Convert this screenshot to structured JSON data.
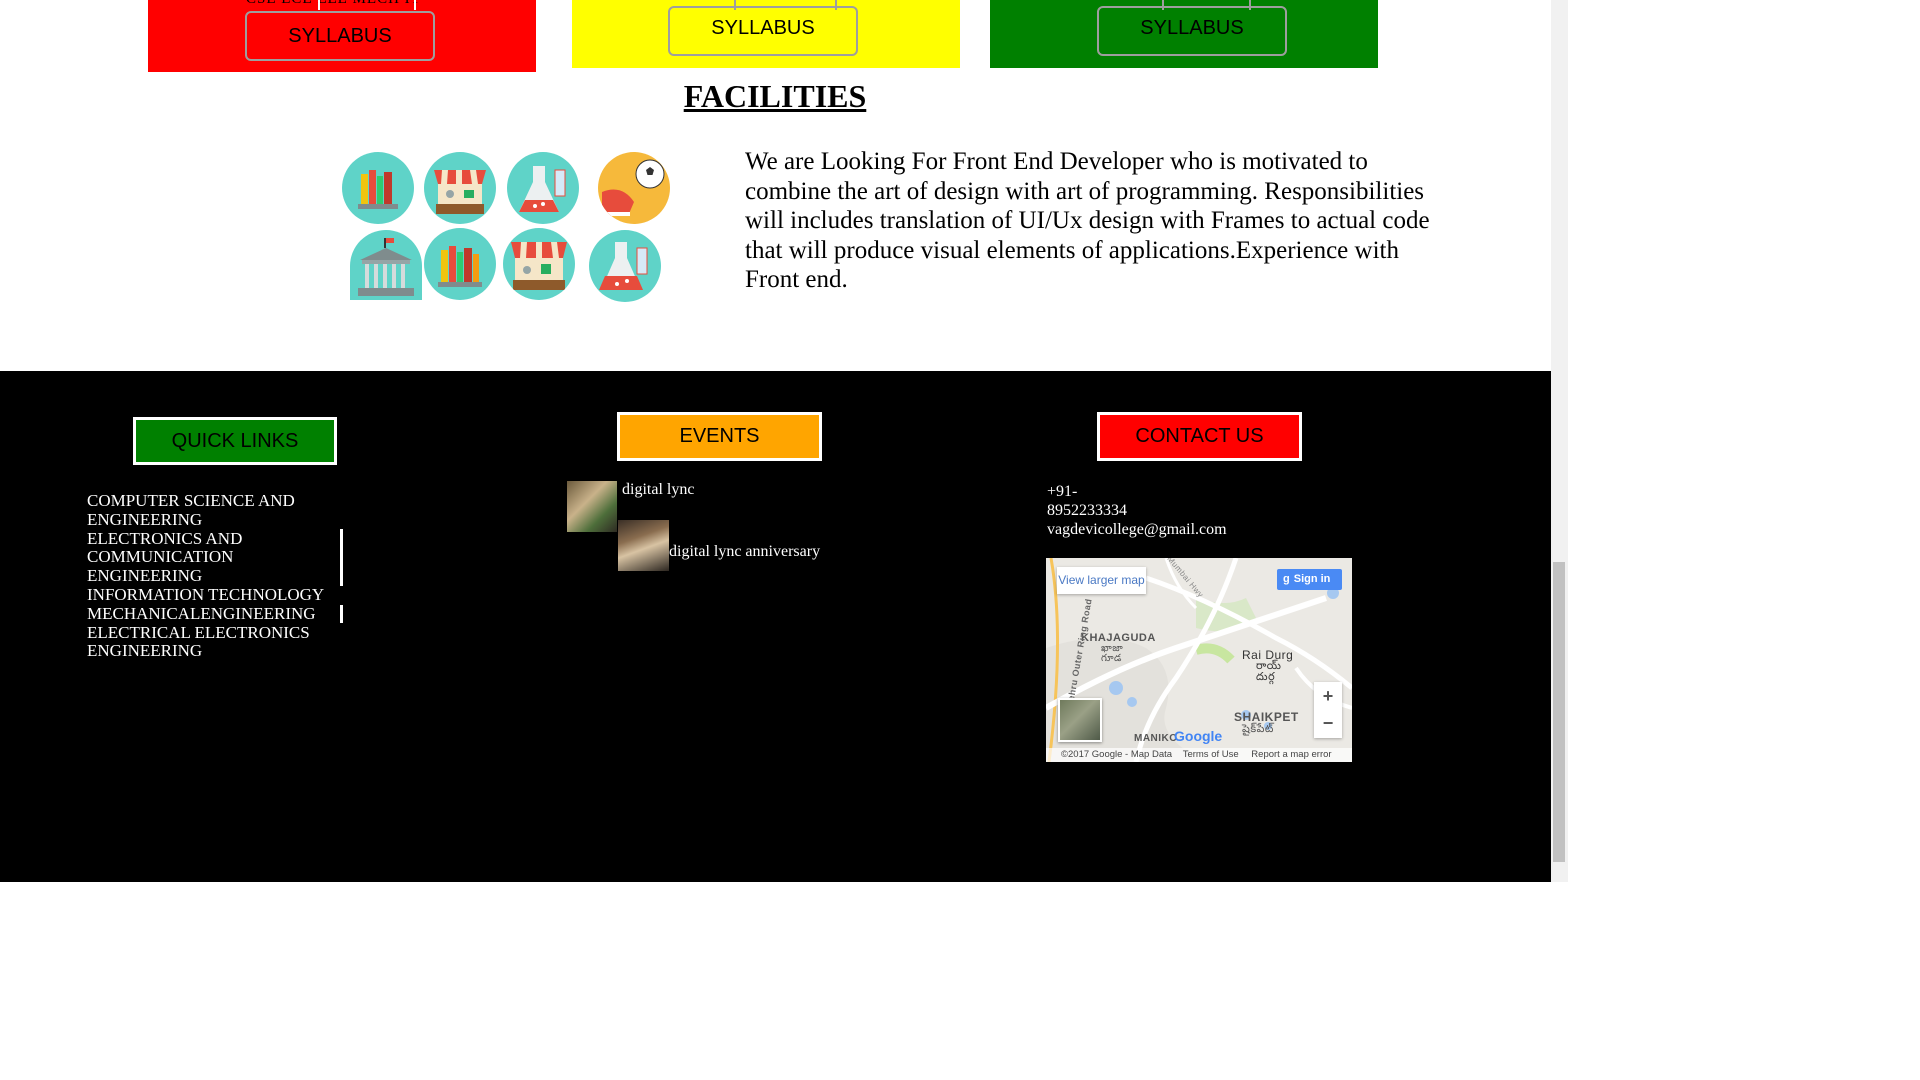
{
  "courses": {
    "cut_label": "CSE  ECE   EEE  MECH   IT",
    "syllabus_label": "SYLLABUS"
  },
  "facilities": {
    "title": "FACILITIES",
    "description": "We are Looking For Front End Developer who is motivated to combine the art of design with art of programming. Responsibilities will includes translation of UI/Ux design with Frames to actual code that will produce visual elements of applications.Experience with Front end.",
    "icons": [
      "library-books-icon",
      "market-stall-icon",
      "chemistry-flask-icon",
      "sports-football-icon",
      "university-building-icon",
      "library-books-icon",
      "market-stall-icon",
      "chemistry-flask-icon"
    ]
  },
  "footer": {
    "quick_links": {
      "label": "QUICK LINKS",
      "color": "#008000",
      "items": [
        "COMPUTER SCIENCE AND ENGINEERING",
        "ELECTRONICS AND COMMUNICATION ENGINEERING",
        "INFORMATION TECHNOLOGY",
        "MECHANICALENGINEERING",
        "ELECTRICAL ELECTRONICS ENGINEERING"
      ]
    },
    "events": {
      "label": "EVENTS",
      "color": "#ffa500",
      "items": [
        "digital lync",
        "digital lync anniversary"
      ]
    },
    "contact": {
      "label": "CONTACT US",
      "color": "#ff0000",
      "phone_prefix": "+91-",
      "phone": "8952233334",
      "email": "vagdevicollege@gmail.com"
    },
    "map": {
      "view_larger": "View larger map",
      "sign_in": "Sign in",
      "labels": {
        "khajaguda": "KHAJAGUDA",
        "khajaguda_te": "ఖాజా\nగూడ",
        "rai_durg": "Rai Durg",
        "rai_durg_te": "రాయ్\nదుర్గ",
        "shaikpet": "SHAIKPET",
        "shaikpet_te": "షైక్‌పేట్",
        "manikonda": "MANIKO",
        "road": "Nehru Outer Ring Road",
        "hwy": "Old Mumbai Hwy"
      },
      "logo": "Google",
      "copyright": "©2017 Google - Map Data",
      "terms": "Terms of Use",
      "report": "Report a map error",
      "zoom_in": "+",
      "zoom_out": "−"
    }
  }
}
